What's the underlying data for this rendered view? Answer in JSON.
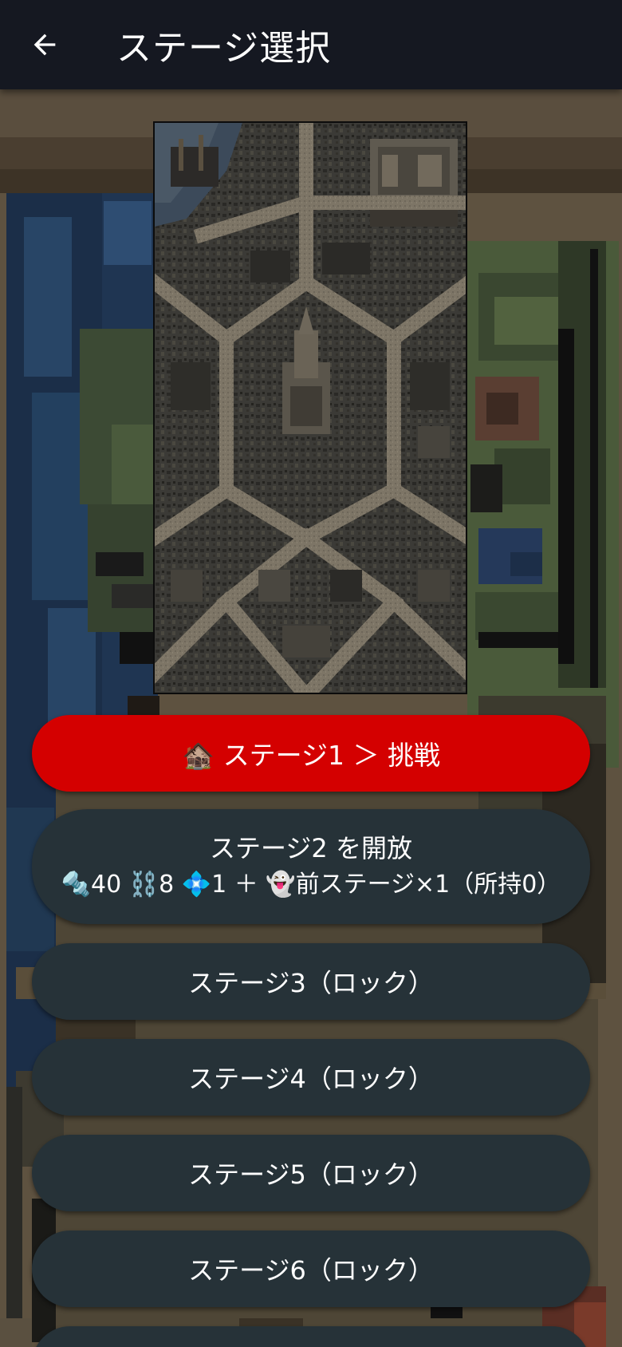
{
  "header": {
    "title": "ステージ選択",
    "back_icon": "arrow-left-icon"
  },
  "colors": {
    "header_bg": "#151821",
    "challenge_button": "#d40000",
    "stage_button": "#263238"
  },
  "stages": {
    "stage1": {
      "label": "🏚️ ステージ1 ＞ 挑戦"
    },
    "stage2": {
      "title": "ステージ2 を開放",
      "cost": "🔩40 ⛓️8 💠1 ＋ 👻前ステージ×1（所持0）"
    },
    "stage3": {
      "label": "ステージ3（ロック）"
    },
    "stage4": {
      "label": "ステージ4（ロック）"
    },
    "stage5": {
      "label": "ステージ5（ロック）"
    },
    "stage6": {
      "label": "ステージ6（ロック）"
    }
  }
}
